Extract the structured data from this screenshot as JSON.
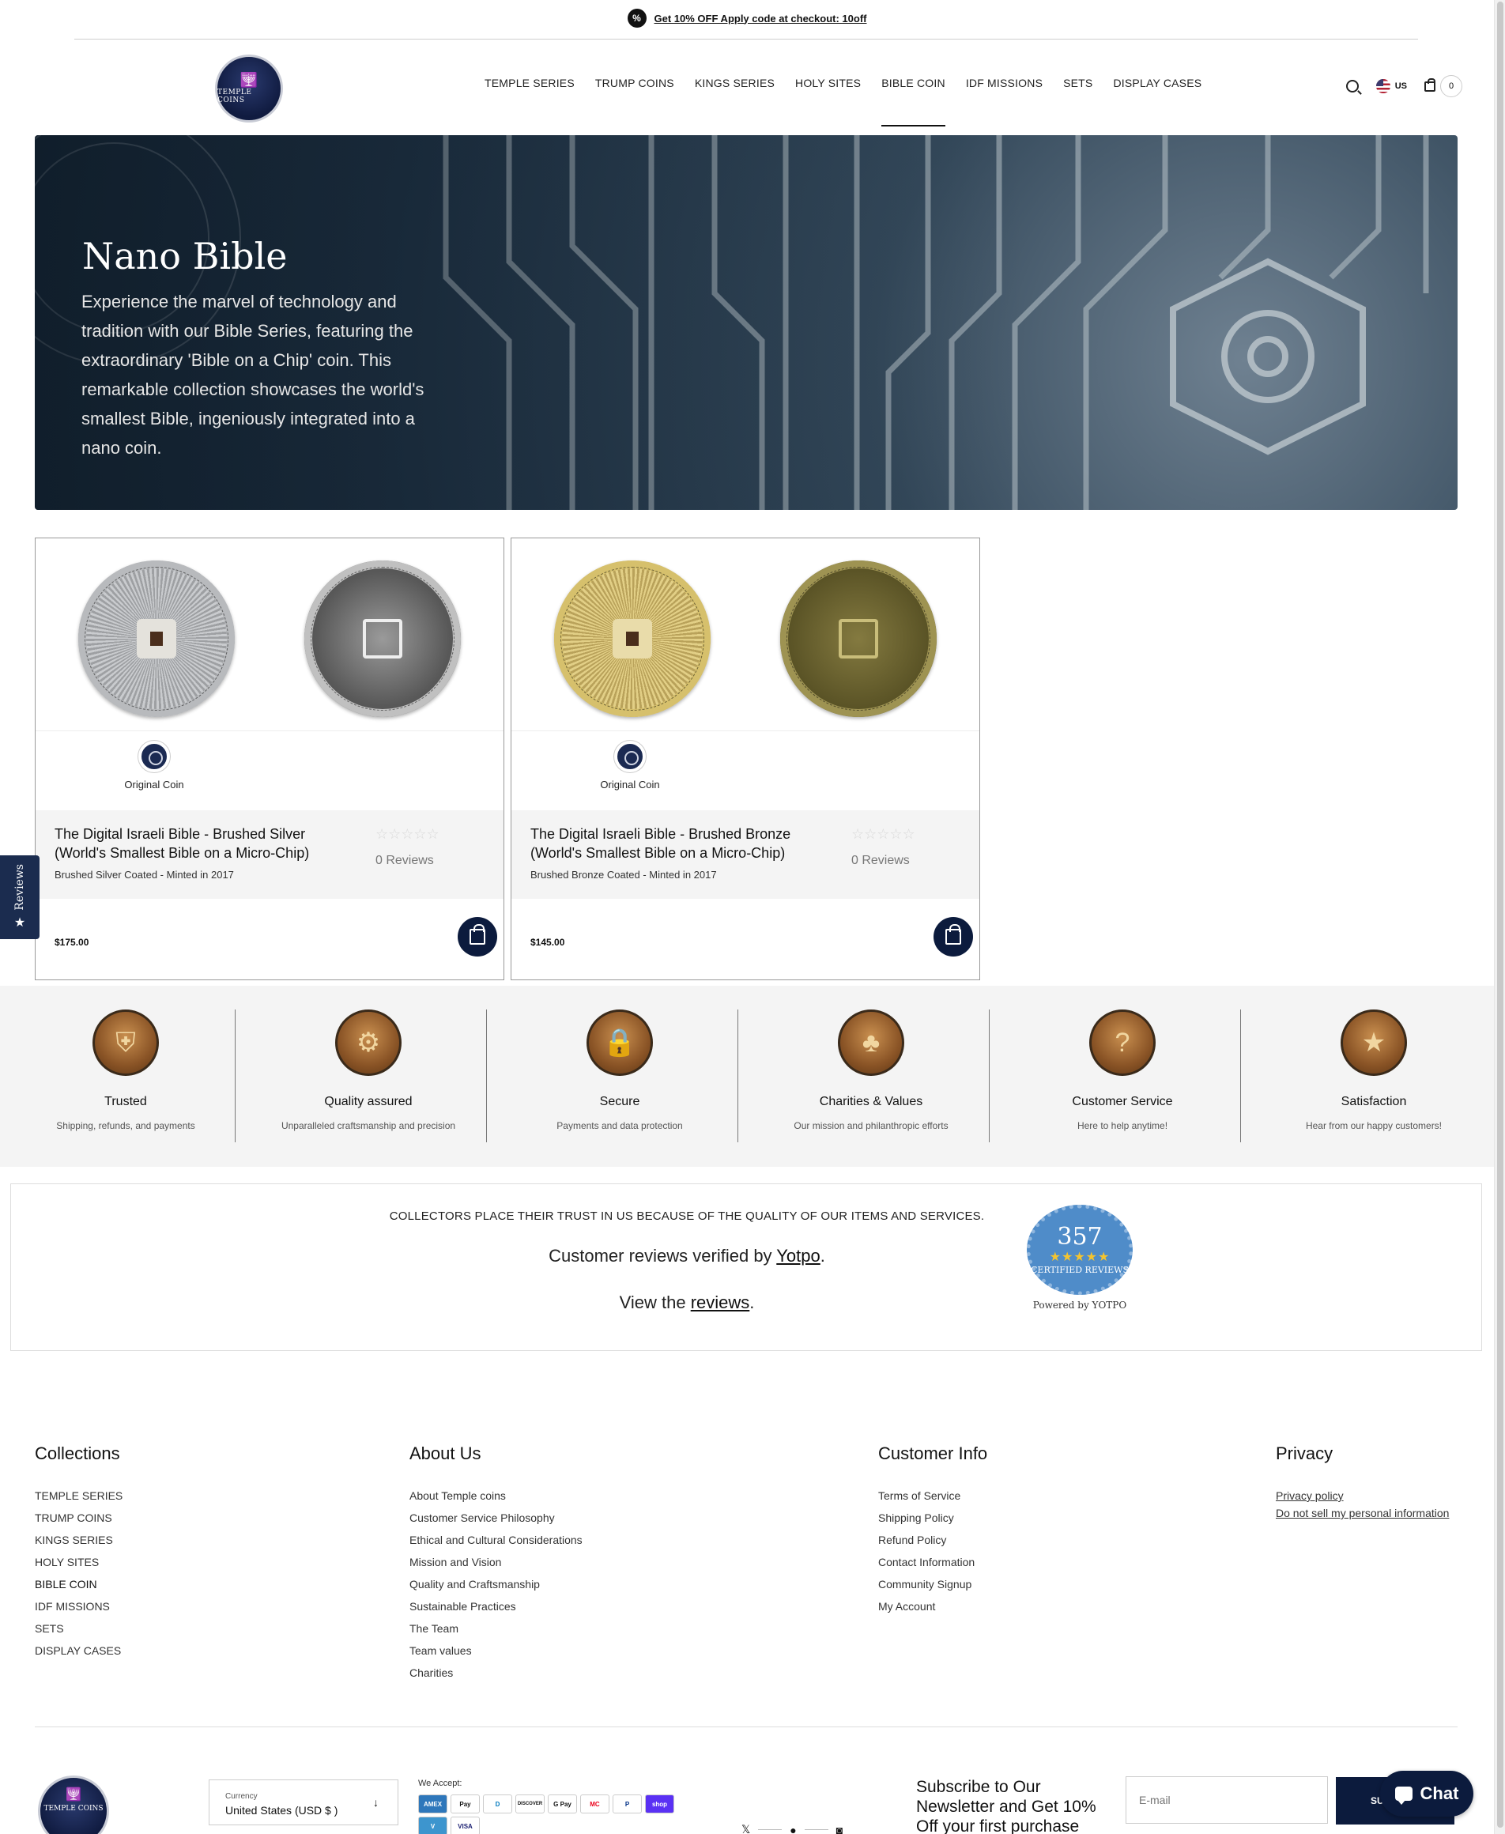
{
  "announcement": {
    "text": "Get 10% OFF Apply code at checkout: 10off"
  },
  "header": {
    "logo_text": "TEMPLE COINS",
    "nav": [
      {
        "label": "TEMPLE SERIES"
      },
      {
        "label": "TRUMP COINS"
      },
      {
        "label": "KINGS SERIES"
      },
      {
        "label": "HOLY SITES"
      },
      {
        "label": "BIBLE COIN",
        "active": true
      },
      {
        "label": "IDF MISSIONS"
      },
      {
        "label": "SETS"
      },
      {
        "label": "DISPLAY CASES"
      }
    ],
    "locale": "US",
    "cart_count": "0"
  },
  "hero": {
    "title": "Nano Bible",
    "text": "Experience the marvel of technology and tradition with our Bible Series, featuring the extraordinary 'Bible on a Chip' coin. This remarkable collection showcases the world's smallest Bible, ingeniously integrated into a nano coin."
  },
  "products": [
    {
      "title": "The Digital Israeli Bible - Brushed Silver (World's Smallest Bible on a Micro-Chip)",
      "subtitle": "Brushed Silver Coated - Minted in 2017",
      "variant": "Original Coin",
      "stars": "☆☆☆☆☆",
      "reviews": "0 Reviews",
      "price": "$175.00"
    },
    {
      "title": "The Digital Israeli Bible - Brushed Bronze (World's Smallest Bible on a Micro-Chip)",
      "subtitle": "Brushed Bronze Coated - Minted in 2017",
      "variant": "Original Coin",
      "stars": "☆☆☆☆☆",
      "reviews": "0 Reviews",
      "price": "$145.00"
    }
  ],
  "reviews_tab": {
    "label": "Reviews"
  },
  "trust_badges": [
    {
      "title": "Trusted",
      "desc": "Shipping, refunds, and payments",
      "icon": "shield-icon"
    },
    {
      "title": "Quality assured",
      "desc": "Unparalleled craftsmanship and precision",
      "icon": "gear-icon"
    },
    {
      "title": "Secure",
      "desc": "Payments and data protection",
      "icon": "lock-icon"
    },
    {
      "title": "Charities & Values",
      "desc": "Our mission and philanthropic efforts",
      "icon": "tree-icon"
    },
    {
      "title": "Customer Service",
      "desc": "Here to help anytime!",
      "icon": "question-icon"
    },
    {
      "title": "Satisfaction",
      "desc": "Hear from our happy customers!",
      "icon": "star-icon"
    }
  ],
  "yotpo": {
    "heading": "COLLECTORS PLACE THEIR TRUST IN US BECAUSE OF THE QUALITY OF OUR ITEMS AND SERVICES.",
    "verified_prefix": "Customer reviews verified by ",
    "verified_link": "Yotpo",
    "view_prefix": "View the ",
    "view_link": "reviews",
    "seal_count": "357",
    "seal_stars": "★★★★★",
    "seal_text": "CERTIFIED REVIEWS",
    "powered": "Powered by YOTPO"
  },
  "footer": {
    "collections": {
      "title": "Collections",
      "links": [
        "TEMPLE SERIES",
        "TRUMP COINS",
        "KINGS SERIES",
        "HOLY SITES",
        "BIBLE COIN",
        "IDF MISSIONS",
        "SETS",
        "DISPLAY CASES"
      ]
    },
    "about": {
      "title": "About Us",
      "links": [
        "About Temple coins",
        "Customer Service Philosophy",
        "Ethical and Cultural Considerations",
        "Mission and Vision",
        "Quality and Craftsmanship",
        "Sustainable Practices",
        "The Team",
        "Team values",
        "Charities"
      ]
    },
    "customer": {
      "title": "Customer Info",
      "links": [
        "Terms of Service",
        "Shipping Policy",
        "Refund Policy",
        "Contact Information",
        "Community Signup",
        "My Account"
      ]
    },
    "privacy": {
      "title": "Privacy",
      "links": [
        "Privacy policy",
        "Do not sell my personal information"
      ]
    },
    "currency_label": "Currency",
    "currency_value": "United States (USD $ )",
    "accept_label": "We Accept:",
    "payments": [
      "AMEX",
      "Pay",
      "D",
      "DISCOVER",
      "G Pay",
      "MC",
      "P",
      "shop",
      "V",
      "VISA"
    ],
    "newsletter": "Subscribe to Our Newsletter and Get 10% Off your first purchase",
    "email_placeholder": "E-mail",
    "subscribe_label": "SUBSCRIBE",
    "chat_label": "Chat"
  }
}
